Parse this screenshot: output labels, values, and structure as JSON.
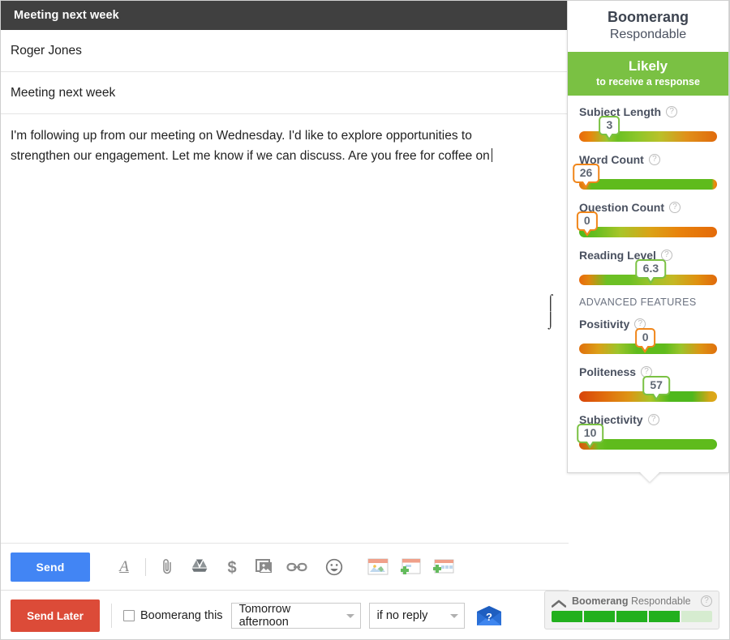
{
  "compose": {
    "window_title": "Meeting next week",
    "to": "Roger Jones",
    "subject": "Meeting next week",
    "body": "I'm following up from our meeting on Wednesday. I'd like to explore opportunities to strengthen our engagement. Let me know if we can discuss. Are you free for coffee on",
    "cursor_icon": "text-i-beam-cursor"
  },
  "toolbar": {
    "send_label": "Send",
    "icons": [
      {
        "name": "format-text-icon",
        "glyph": "A"
      },
      {
        "name": "attach-file-icon",
        "glyph": "paperclip"
      },
      {
        "name": "google-drive-icon",
        "glyph": "drive"
      },
      {
        "name": "insert-money-icon",
        "glyph": "$"
      },
      {
        "name": "insert-photo-icon",
        "glyph": "photo"
      },
      {
        "name": "insert-link-icon",
        "glyph": "link"
      },
      {
        "name": "insert-emoji-icon",
        "glyph": "smiley"
      },
      {
        "name": "insert-template-icon",
        "glyph": "template"
      },
      {
        "name": "new-template-icon",
        "glyph": "template-add"
      },
      {
        "name": "insert-snippet-icon",
        "glyph": "snippet-add"
      }
    ]
  },
  "toolbar2": {
    "send_later_label": "Send Later",
    "boomerang_checkbox_label": "Boomerang this",
    "boomerang_checked": false,
    "when_select_value": "Tomorrow afternoon",
    "condition_select_value": "if no reply",
    "help_icon": "help-envelope-icon"
  },
  "panel": {
    "title": "Boomerang",
    "subtitle": "Respondable",
    "banner_main": "Likely",
    "banner_sub": "to receive a response",
    "banner_color": "#7ac143",
    "advanced_header": "ADVANCED FEATURES",
    "help_glyph": "?",
    "metrics": [
      {
        "label": "Subject Length",
        "value": "3",
        "pos": 22,
        "tone": "green"
      },
      {
        "label": "Word Count",
        "value": "26",
        "pos": 5,
        "tone": "orange"
      },
      {
        "label": "Question Count",
        "value": "0",
        "pos": 0,
        "tone": "orange"
      },
      {
        "label": "Reading Level",
        "value": "6.3",
        "pos": 52,
        "tone": "green"
      }
    ],
    "advanced_metrics": [
      {
        "label": "Positivity",
        "value": "0",
        "pos": 48,
        "tone": "orange"
      },
      {
        "label": "Politeness",
        "value": "57",
        "pos": 56,
        "tone": "green"
      },
      {
        "label": "Subjectivity",
        "value": "10",
        "pos": 8,
        "tone": "green"
      }
    ]
  },
  "bottom_widget": {
    "label_bold": "Boomerang",
    "label_rest": "Respondable",
    "help_glyph": "?",
    "collapse_icon": "chevron-up-icon",
    "segments_total": 5,
    "segments_filled": 4,
    "fill_color": "#22b01e"
  }
}
